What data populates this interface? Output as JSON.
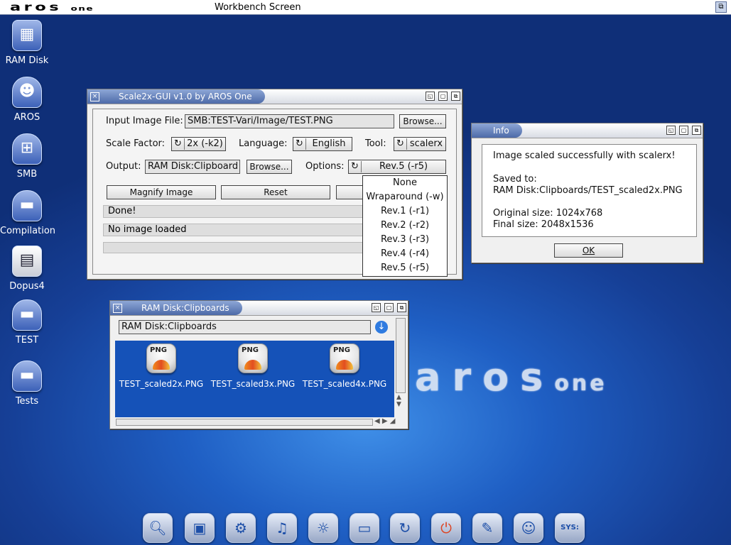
{
  "screen": {
    "logo": "aros",
    "logo_suffix": "one",
    "title": "Workbench Screen"
  },
  "desktop_icons": [
    {
      "label": "RAM Disk",
      "icon": "ram-disk-icon"
    },
    {
      "label": "AROS",
      "icon": "aros-drive-icon"
    },
    {
      "label": "SMB",
      "icon": "network-drive-icon"
    },
    {
      "label": "Compilation",
      "icon": "drive-icon"
    },
    {
      "label": "Dopus4",
      "icon": "dopus-icon"
    },
    {
      "label": "TEST",
      "icon": "drive-icon"
    },
    {
      "label": "Tests",
      "icon": "drive-icon"
    }
  ],
  "background_logo": {
    "text": "aros",
    "suffix": "one"
  },
  "scale_window": {
    "title": "Scale2x-GUI v1.0 by AROS One",
    "input_label": "Input Image File:",
    "input_value": "SMB:TEST-Vari/Image/TEST.PNG",
    "browse1": "Browse...",
    "scale_label": "Scale Factor:",
    "scale_value": "2x (-k2)",
    "language_label": "Language:",
    "language_value": "English",
    "tool_label": "Tool:",
    "tool_value": "scalerx",
    "output_label": "Output:",
    "output_value": "RAM Disk:Clipboard",
    "browse2": "Browse...",
    "options_label": "Options:",
    "options_value": "Rev.5 (-r5)",
    "magnify": "Magnify Image",
    "reset": "Reset",
    "status1": "Done!",
    "status2": "No image loaded"
  },
  "options_popup": [
    "None",
    "Wraparound (-w)",
    "Rev.1 (-r1)",
    "Rev.2 (-r2)",
    "Rev.3 (-r3)",
    "Rev.4 (-r4)",
    "Rev.5 (-r5)"
  ],
  "info_window": {
    "title": "Info",
    "line1": "Image scaled successfully with scalerx!",
    "line2": "Saved to:",
    "line3": "RAM Disk:Clipboards/TEST_scaled2x.PNG",
    "line4": "Original size: 1024x768",
    "line5": "Final size: 2048x1536",
    "ok": "OK"
  },
  "drawer_window": {
    "title": "RAM Disk:Clipboards",
    "path": "RAM Disk:Clipboards",
    "files": [
      "TEST_scaled2x.PNG",
      "TEST_scaled3x.PNG",
      "TEST_scaled4x.PNG"
    ],
    "file_badge": "PNG"
  },
  "dock": [
    "search-icon",
    "display-icon",
    "magnifier-gear-icon",
    "music-icon",
    "indian-icon",
    "monitor-icon",
    "refresh-icon",
    "power-icon",
    "shell-icon",
    "boing-icon",
    "sys-icon"
  ],
  "dock_sys_label": "SYS:"
}
